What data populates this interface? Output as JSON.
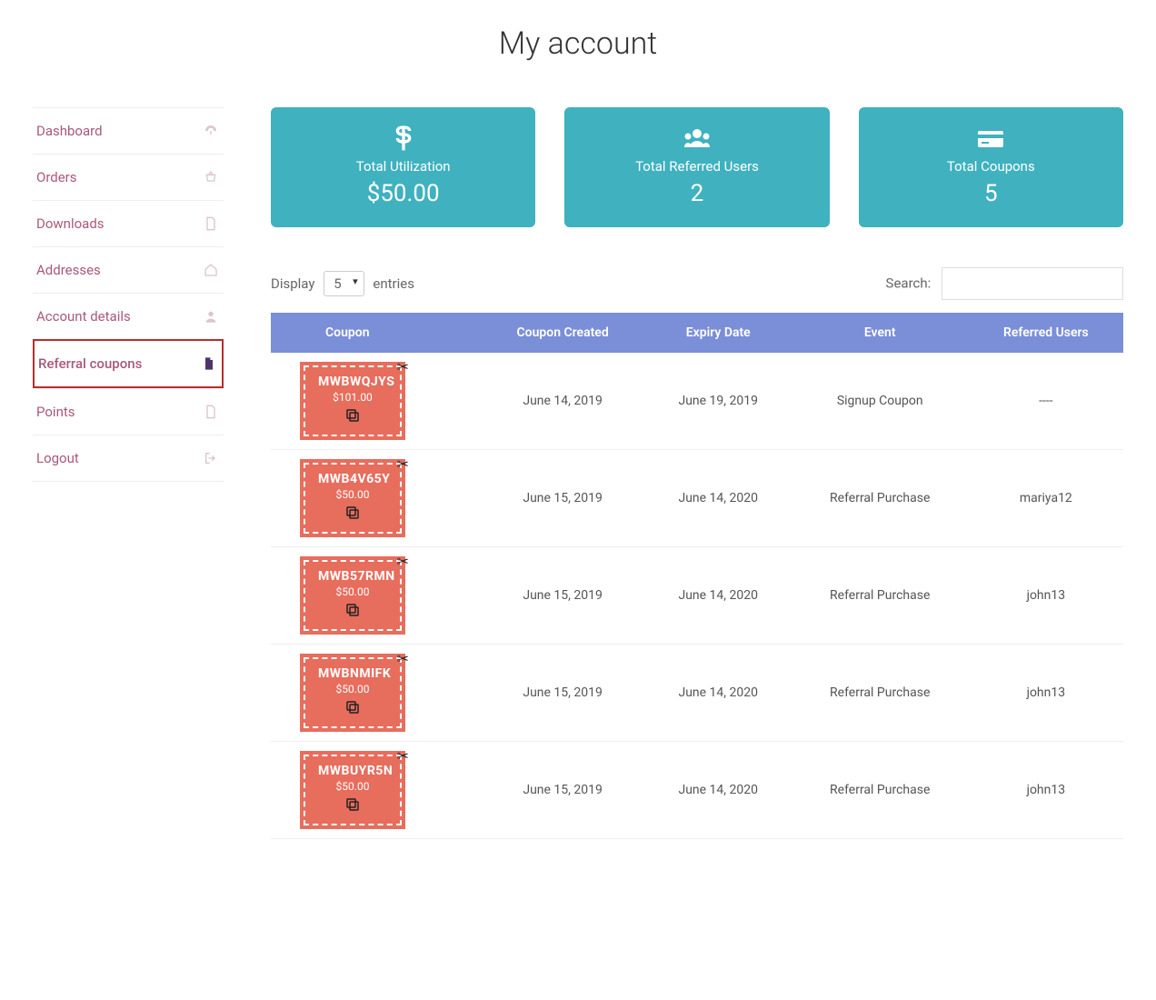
{
  "page": {
    "title": "My account"
  },
  "sidebar": {
    "items": [
      {
        "label": "Dashboard",
        "icon": "dashboard"
      },
      {
        "label": "Orders",
        "icon": "basket"
      },
      {
        "label": "Downloads",
        "icon": "file"
      },
      {
        "label": "Addresses",
        "icon": "home"
      },
      {
        "label": "Account details",
        "icon": "user"
      },
      {
        "label": "Referral coupons",
        "icon": "doc",
        "active": true
      },
      {
        "label": "Points",
        "icon": "file"
      },
      {
        "label": "Logout",
        "icon": "signout"
      }
    ]
  },
  "stats": [
    {
      "icon": "dollar",
      "label": "Total Utilization",
      "value": "$50.00"
    },
    {
      "icon": "users",
      "label": "Total Referred Users",
      "value": "2"
    },
    {
      "icon": "coupons",
      "label": "Total Coupons",
      "value": "5"
    }
  ],
  "controls": {
    "display_label_pre": "Display",
    "display_value": "5",
    "display_label_post": "entries",
    "search_label": "Search:"
  },
  "table": {
    "headers": [
      "Coupon",
      "Coupon Created",
      "Expiry Date",
      "Event",
      "Referred Users"
    ],
    "rows": [
      {
        "code": "MWBWQJYS",
        "amount": "$101.00",
        "created": "June 14, 2019",
        "expiry": "June 19, 2019",
        "event": "Signup Coupon",
        "user": "----"
      },
      {
        "code": "MWB4V65Y",
        "amount": "$50.00",
        "created": "June 15, 2019",
        "expiry": "June 14, 2020",
        "event": "Referral Purchase",
        "user": "mariya12"
      },
      {
        "code": "MWB57RMN",
        "amount": "$50.00",
        "created": "June 15, 2019",
        "expiry": "June 14, 2020",
        "event": "Referral Purchase",
        "user": "john13"
      },
      {
        "code": "MWBNMIFK",
        "amount": "$50.00",
        "created": "June 15, 2019",
        "expiry": "June 14, 2020",
        "event": "Referral Purchase",
        "user": "john13"
      },
      {
        "code": "MWBUYR5N",
        "amount": "$50.00",
        "created": "June 15, 2019",
        "expiry": "June 14, 2020",
        "event": "Referral Purchase",
        "user": "john13"
      }
    ]
  }
}
